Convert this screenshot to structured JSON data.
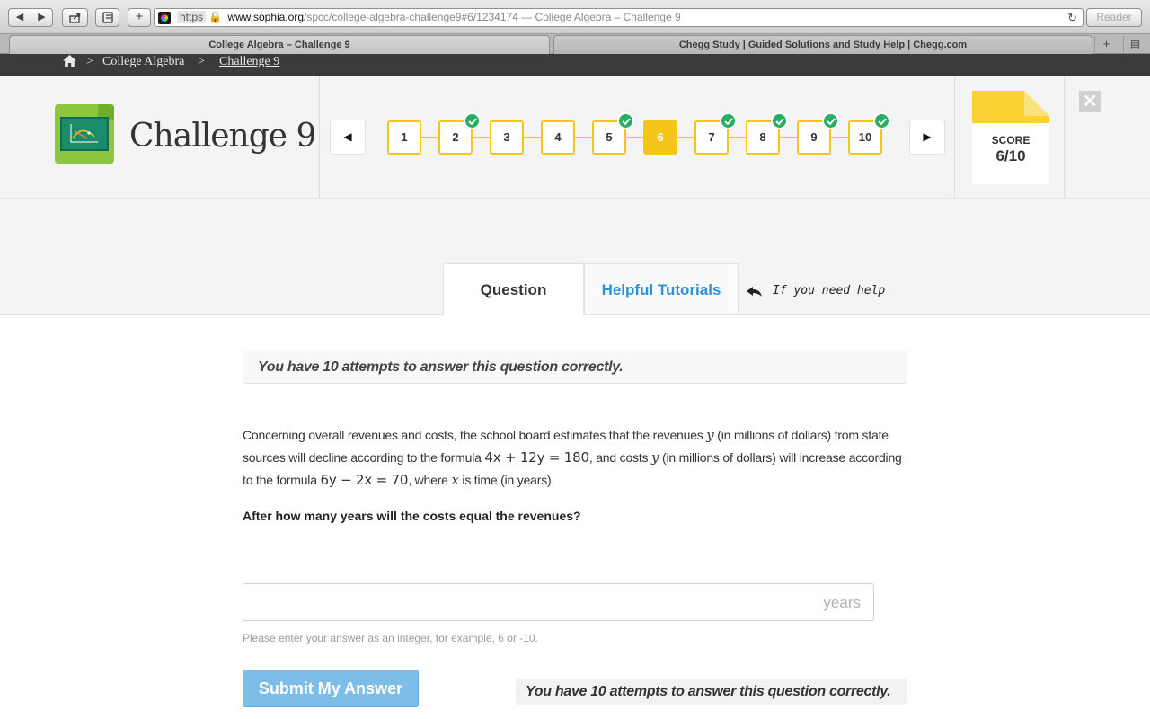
{
  "browser": {
    "nav_back": "◀",
    "nav_forward": "▶",
    "share_icon": "share-icon",
    "add_icon": "+",
    "url_scheme": "https",
    "url_domain": "www.sophia.org",
    "url_path": "/spcc/college-algebra-challenge9#6/1234174",
    "url_title": " — College Algebra – Challenge 9",
    "reader_label": "Reader",
    "tabs": [
      {
        "label": "College Algebra – Challenge 9"
      },
      {
        "label": "Chegg Study | Guided Solutions and Study Help | Chegg.com"
      }
    ]
  },
  "breadcrumb": {
    "sep": ">",
    "items": [
      "College Algebra",
      "Challenge 9"
    ]
  },
  "header": {
    "title": "Challenge 9",
    "steps": [
      {
        "label": "1",
        "completed": false
      },
      {
        "label": "2",
        "completed": true
      },
      {
        "label": "3",
        "completed": false
      },
      {
        "label": "4",
        "completed": false
      },
      {
        "label": "5",
        "completed": true
      },
      {
        "label": "6",
        "current": true
      },
      {
        "label": "7",
        "completed": true
      },
      {
        "label": "8",
        "completed": true
      },
      {
        "label": "9",
        "completed": true
      },
      {
        "label": "10",
        "completed": true
      }
    ],
    "score_label": "SCORE",
    "score_value": "6/10",
    "close_icon": "✕"
  },
  "tabs": {
    "question": "Question",
    "tutorials": "Helpful Tutorials",
    "help_note": "If you need help"
  },
  "content": {
    "attempts_notice": "You have 10 attempts to answer this question correctly.",
    "problem_parts": {
      "p1": "Concerning overall revenues and costs, the school board estimates that the revenues ",
      "var_y1": "y",
      "p2": " (in millions of dollars) from state sources will decline according to the formula ",
      "formula1": "4x + 12y = 180",
      "p3": ", and costs ",
      "var_y2": "y",
      "p4": " (in millions of dollars) will increase according to the formula ",
      "formula2": "6y − 2x = 70",
      "p5": ", where ",
      "var_x": "x",
      "p6": " is time (in years)."
    },
    "question": "After how many years will the costs equal the revenues?",
    "answer_value": "",
    "answer_units": "years",
    "hint": "Please enter your answer as an integer, for example, 6 or -10.",
    "submit_label": "Submit My Answer"
  },
  "colors": {
    "accent_yellow": "#f5c518",
    "check_green": "#27ae60",
    "link_blue": "#2f8fd7",
    "submit_blue": "#7fbde9"
  }
}
